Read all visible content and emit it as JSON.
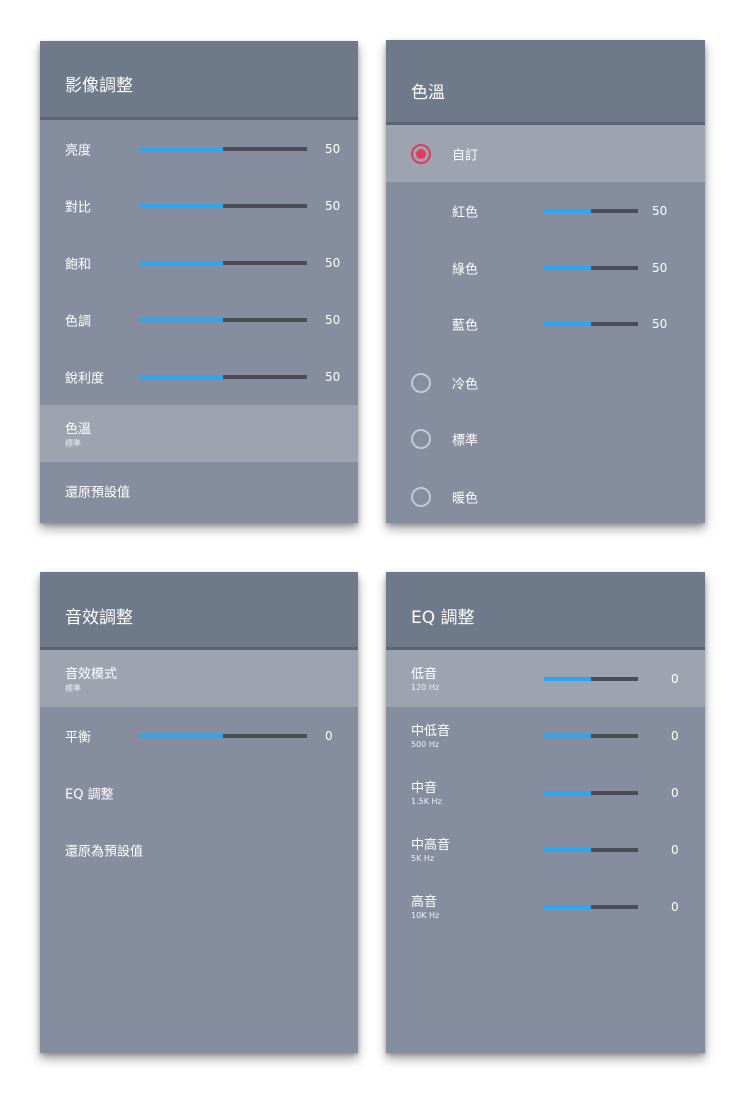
{
  "picture_panel": {
    "title": "影像調整",
    "items": [
      {
        "label": "亮度",
        "value": "50",
        "level": 0.5
      },
      {
        "label": "對比",
        "value": "50",
        "level": 0.5
      },
      {
        "label": "飽和",
        "value": "50",
        "level": 0.5
      },
      {
        "label": "色調",
        "value": "50",
        "level": 0.5
      },
      {
        "label": "銳利度",
        "value": "50",
        "level": 0.5
      }
    ],
    "color_temp": {
      "label": "色溫",
      "sub": "標準"
    },
    "reset_label": "還原預設值"
  },
  "color_temp_panel": {
    "title": "色溫",
    "options": [
      {
        "label": "自訂",
        "selected": true
      },
      {
        "label": "冷色",
        "selected": false
      },
      {
        "label": "標準",
        "selected": false
      },
      {
        "label": "暖色",
        "selected": false
      }
    ],
    "channels": [
      {
        "label": "紅色",
        "value": "50",
        "level": 0.5
      },
      {
        "label": "綠色",
        "value": "50",
        "level": 0.5
      },
      {
        "label": "藍色",
        "value": "50",
        "level": 0.5
      }
    ]
  },
  "sound_panel": {
    "title": "音效調整",
    "mode": {
      "label": "音效模式",
      "sub": "標準"
    },
    "balance": {
      "label": "平衡",
      "value": "0",
      "level": 0.5
    },
    "eq_label": "EQ 調整",
    "reset_label": "還原為預設值"
  },
  "eq_panel": {
    "title": "EQ 調整",
    "bands": [
      {
        "label": "低音",
        "freq": "120 Hz",
        "value": "0",
        "level": 0.5
      },
      {
        "label": "中低音",
        "freq": "500 Hz",
        "value": "0",
        "level": 0.5
      },
      {
        "label": "中音",
        "freq": "1.5K Hz",
        "value": "0",
        "level": 0.5
      },
      {
        "label": "中高音",
        "freq": "5K Hz",
        "value": "0",
        "level": 0.5
      },
      {
        "label": "高音",
        "freq": "10K Hz",
        "value": "0",
        "level": 0.5
      }
    ]
  },
  "colors": {
    "panel_bg": "#868d9e",
    "header_bg": "#6e7a8a",
    "selected_row": "#9ea4af",
    "slider_fill": "#29a7ef",
    "slider_track": "#4a4d55",
    "radio_selected": "#e03a5e"
  }
}
